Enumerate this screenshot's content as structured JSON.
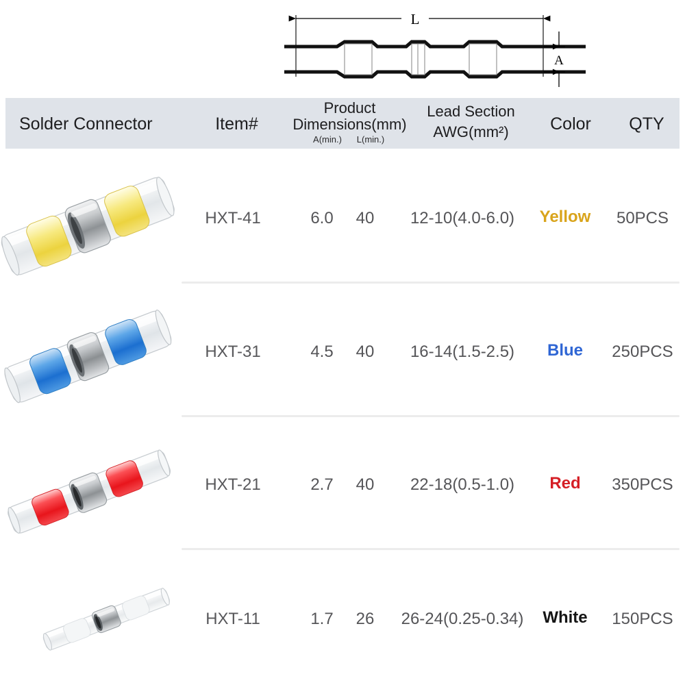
{
  "diagram": {
    "label_length": "L",
    "label_diameter": "A",
    "description": "solder-seal connector cross-section with L length dimension and A diameter dimension"
  },
  "table": {
    "columns": [
      {
        "key": "connector",
        "label": "Solder Connector"
      },
      {
        "key": "item",
        "label": "Item#"
      },
      {
        "key": "dims",
        "label_line1": "Product",
        "label_line2": "Dimensions(mm)",
        "sub_a": "A(min.)",
        "sub_l": "L(min.)"
      },
      {
        "key": "lead",
        "label_line1": "Lead Section",
        "label_line2": "AWG(mm²)"
      },
      {
        "key": "color",
        "label": "Color"
      },
      {
        "key": "qty",
        "label": "QTY"
      }
    ],
    "rows": [
      {
        "item": "HXT-41",
        "a_min": "6.0",
        "l_min": "40",
        "lead_section": "12-10(4.0-6.0)",
        "color": "Yellow",
        "color_hex": "#d9a41c",
        "qty": "50PCS",
        "product_image": "solder-connector-yellow"
      },
      {
        "item": "HXT-31",
        "a_min": "4.5",
        "l_min": "40",
        "lead_section": "16-14(1.5-2.5)",
        "color": "Blue",
        "color_hex": "#2f66d4",
        "qty": "250PCS",
        "product_image": "solder-connector-blue"
      },
      {
        "item": "HXT-21",
        "a_min": "2.7",
        "l_min": "40",
        "lead_section": "22-18(0.5-1.0)",
        "color": "Red",
        "color_hex": "#d51f26",
        "qty": "350PCS",
        "product_image": "solder-connector-red"
      },
      {
        "item": "HXT-11",
        "a_min": "1.7",
        "l_min": "26",
        "lead_section": "26-24(0.25-0.34)",
        "color": "White",
        "color_hex": "#151515",
        "qty": "150PCS",
        "product_image": "solder-connector-white"
      }
    ]
  },
  "theme": {
    "header_background": "#dfe3e9",
    "divider": "#ececec",
    "text": "#555558",
    "page_background": "#ffffff"
  }
}
